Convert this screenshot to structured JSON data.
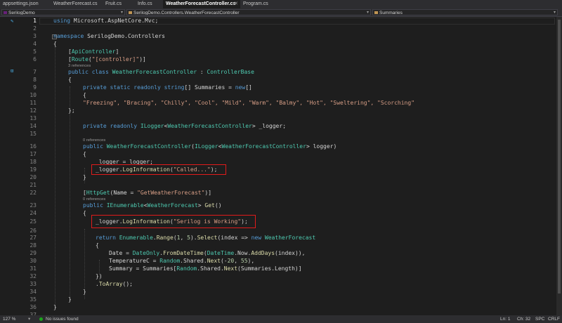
{
  "tabs": [
    {
      "label": "appsettings.json",
      "active": false
    },
    {
      "label": "WeatherForecast.cs",
      "active": false
    },
    {
      "label": "Fruit.cs",
      "active": false
    },
    {
      "label": "Info.cs",
      "active": false
    },
    {
      "label": "WeatherForecastController.cs",
      "active": true
    },
    {
      "label": "Program.cs",
      "active": false
    }
  ],
  "nav": {
    "project": "SerilogDemo",
    "class": "SerilogDemo.Controllers.WeatherForecastController",
    "member": "Summaries"
  },
  "codelens": {
    "refs3": "3 references",
    "refs0a": "0 references",
    "refs0b": "0 references"
  },
  "lines": [
    {
      "n": "1"
    },
    {
      "n": "2"
    },
    {
      "n": "3"
    },
    {
      "n": "4"
    },
    {
      "n": "5"
    },
    {
      "n": "6"
    },
    {
      "n": "7"
    },
    {
      "n": "8"
    },
    {
      "n": "9"
    },
    {
      "n": "10"
    },
    {
      "n": "11"
    },
    {
      "n": "12"
    },
    {
      "n": "13"
    },
    {
      "n": "14"
    },
    {
      "n": "15"
    },
    {
      "n": "16"
    },
    {
      "n": "17"
    },
    {
      "n": "18"
    },
    {
      "n": "19"
    },
    {
      "n": "20"
    },
    {
      "n": "21"
    },
    {
      "n": "22"
    },
    {
      "n": "23"
    },
    {
      "n": "24"
    },
    {
      "n": "25"
    },
    {
      "n": "26"
    },
    {
      "n": "27"
    },
    {
      "n": "28"
    },
    {
      "n": "29"
    },
    {
      "n": "30"
    },
    {
      "n": "31"
    },
    {
      "n": "32"
    },
    {
      "n": "33"
    },
    {
      "n": "34"
    },
    {
      "n": "35"
    },
    {
      "n": "36"
    },
    {
      "n": "37"
    }
  ],
  "code": {
    "l1_kw": "using",
    "l1_rest": " Microsoft.AspNetCore.Mvc;",
    "l3_kw": "namespace",
    "l3_rest": " SerilogDemo.Controllers",
    "l4": "{",
    "l5_a": "[",
    "l5_b": "ApiController",
    "l5_c": "]",
    "l6_a": "[",
    "l6_b": "Route",
    "l6_c": "(",
    "l6_d": "\"[controller]\"",
    "l6_e": ")]",
    "l7_kw": "public class",
    "l7_ty": " WeatherForecastController",
    "l7_mid": " : ",
    "l7_base": "ControllerBase",
    "l8": "{",
    "l9_kw": "private static readonly string",
    "l9_rest": "[] Summaries = ",
    "l9_new": "new",
    "l9_end": "[]",
    "l10": "{",
    "l11": "\"Freezing\", \"Bracing\", \"Chilly\", \"Cool\", \"Mild\", \"Warm\", \"Balmy\", \"Hot\", \"Sweltering\", \"Scorching\"",
    "l12": "};",
    "l14_kw": "private readonly",
    "l14_ty": " ILogger",
    "l14_lt": "<",
    "l14_ty2": "WeatherForecastController",
    "l14_rest": "> _logger;",
    "l16_kw": "public",
    "l16_ty": " WeatherForecastController",
    "l16_a": "(",
    "l16_ty2": "ILogger",
    "l16_b": "<",
    "l16_ty3": "WeatherForecastController",
    "l16_c": "> logger)",
    "l17": "{",
    "l18": "_logger = logger;",
    "l19_a": "_logger.",
    "l19_m": "LogInformation",
    "l19_b": "(",
    "l19_s": "\"Called...\"",
    "l19_c": ");",
    "l20": "}",
    "l22_a": "[",
    "l22_b": "HttpGet",
    "l22_c": "(Name = ",
    "l22_s": "\"GetWeatherForecast\"",
    "l22_d": ")]",
    "l23_kw": "public",
    "l23_ty": " IEnumerable",
    "l23_a": "<",
    "l23_ty2": "WeatherForecast",
    "l23_b": "> ",
    "l23_m": "Get",
    "l23_c": "()",
    "l24": "{",
    "l25_a": "_logger.",
    "l25_m": "LogInformation",
    "l25_b": "(",
    "l25_s": "\"Serilog is Working\"",
    "l25_c": ");",
    "l27_kw": "return",
    "l27_ty": " Enumerable",
    "l27_a": ".",
    "l27_m": "Range",
    "l27_b": "(",
    "l27_n1": "1",
    "l27_c": ", ",
    "l27_n2": "5",
    "l27_d": ").",
    "l27_m2": "Select",
    "l27_e": "(index => ",
    "l27_new": "new",
    "l27_ty2": " WeatherForecast",
    "l28": "{",
    "l29_a": "Date = ",
    "l29_ty": "DateOnly",
    "l29_b": ".",
    "l29_m": "FromDateTime",
    "l29_c": "(",
    "l29_ty2": "DateTime",
    "l29_d": ".Now.",
    "l29_m2": "AddDays",
    "l29_e": "(index)),",
    "l30_a": "TemperatureC = ",
    "l30_ty": "Random",
    "l30_b": ".Shared.",
    "l30_m": "Next",
    "l30_c": "(-",
    "l30_n1": "20",
    "l30_d": ", ",
    "l30_n2": "55",
    "l30_e": "),",
    "l31_a": "Summary = Summaries[",
    "l31_ty": "Random",
    "l31_b": ".Shared.",
    "l31_m": "Next",
    "l31_c": "(Summaries.Length)]",
    "l32": "})",
    "l33_a": ".",
    "l33_m": "ToArray",
    "l33_b": "();",
    "l34": "}",
    "l35": "}",
    "l36": "}"
  },
  "status": {
    "zoom": "127 %",
    "issues": "No issues found",
    "ln": "Ln: 1",
    "ch": "Ch: 32",
    "spc": "SPC",
    "crlf": "CRLF"
  },
  "colors": {
    "keyword": "#569cd6",
    "type": "#4ec9b0",
    "string": "#d69d85",
    "method": "#dcdcaa",
    "number": "#b5cea8",
    "highlight_box": "#e11b1b"
  }
}
